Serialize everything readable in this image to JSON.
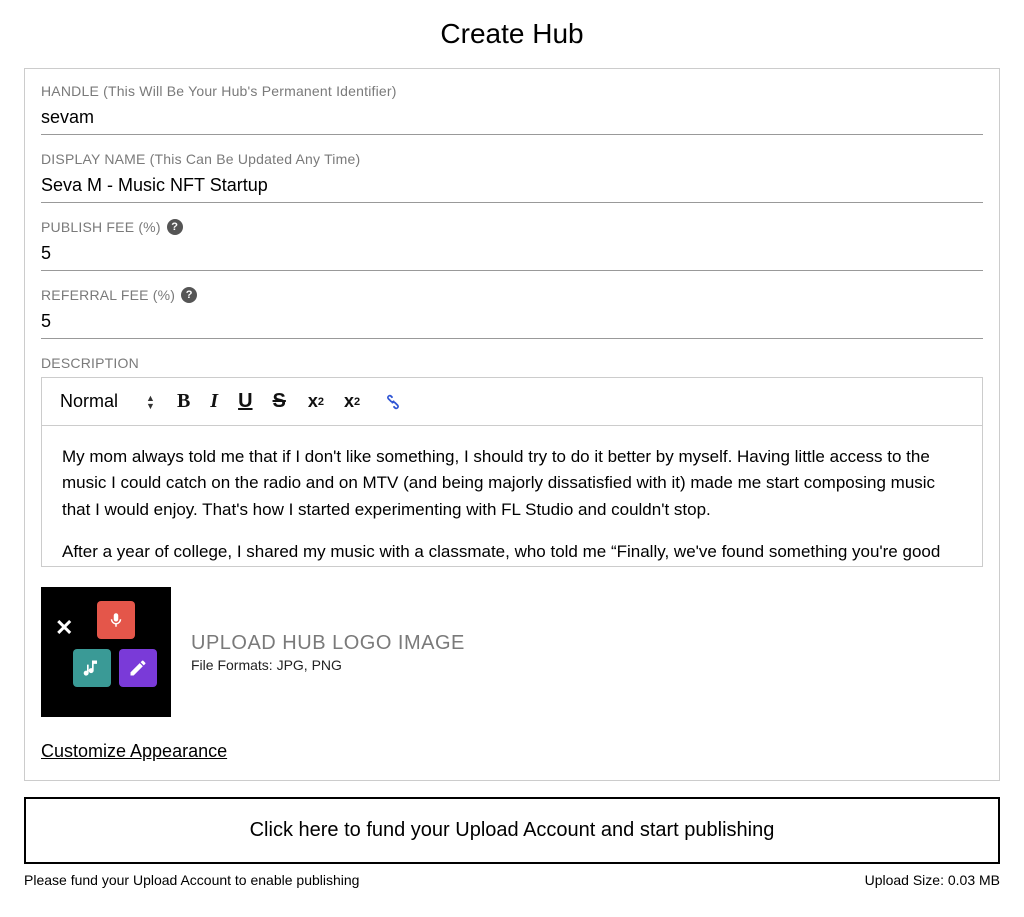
{
  "page": {
    "title": "Create Hub"
  },
  "fields": {
    "handle": {
      "label": "HANDLE (This Will Be Your Hub's Permanent Identifier)",
      "value": "sevam"
    },
    "display": {
      "label": "DISPLAY NAME (This Can Be Updated Any Time)",
      "value": "Seva M - Music NFT Startup"
    },
    "publish": {
      "label": "PUBLISH FEE (%)",
      "value": "5"
    },
    "referral": {
      "label": "REFERRAL FEE (%)",
      "value": "5"
    },
    "description_label": "DESCRIPTION"
  },
  "toolbar": {
    "format": "Normal",
    "bold": "B",
    "italic": "I",
    "underline": "U",
    "strike": "S"
  },
  "description": {
    "para1": "My mom always told me that if I don't like something, I should try to do it better by myself. Having little access to the music I could catch on the radio and on MTV (and being majorly dissatisfied with it) made me start composing music that I would enjoy. That's how I started experimenting with FL Studio and couldn't stop.",
    "para2": "After a year of college, I shared my music with a classmate, who told me “Finally, we've found something you're good at!”"
  },
  "upload": {
    "title": "UPLOAD HUB LOGO IMAGE",
    "subtitle": "File Formats: JPG, PNG"
  },
  "customize_link": "Customize Appearance",
  "fund_button": "Click here to fund your Upload Account and start publishing",
  "footer": {
    "left": "Please fund your Upload Account to enable publishing",
    "right": "Upload Size: 0.03 MB"
  }
}
